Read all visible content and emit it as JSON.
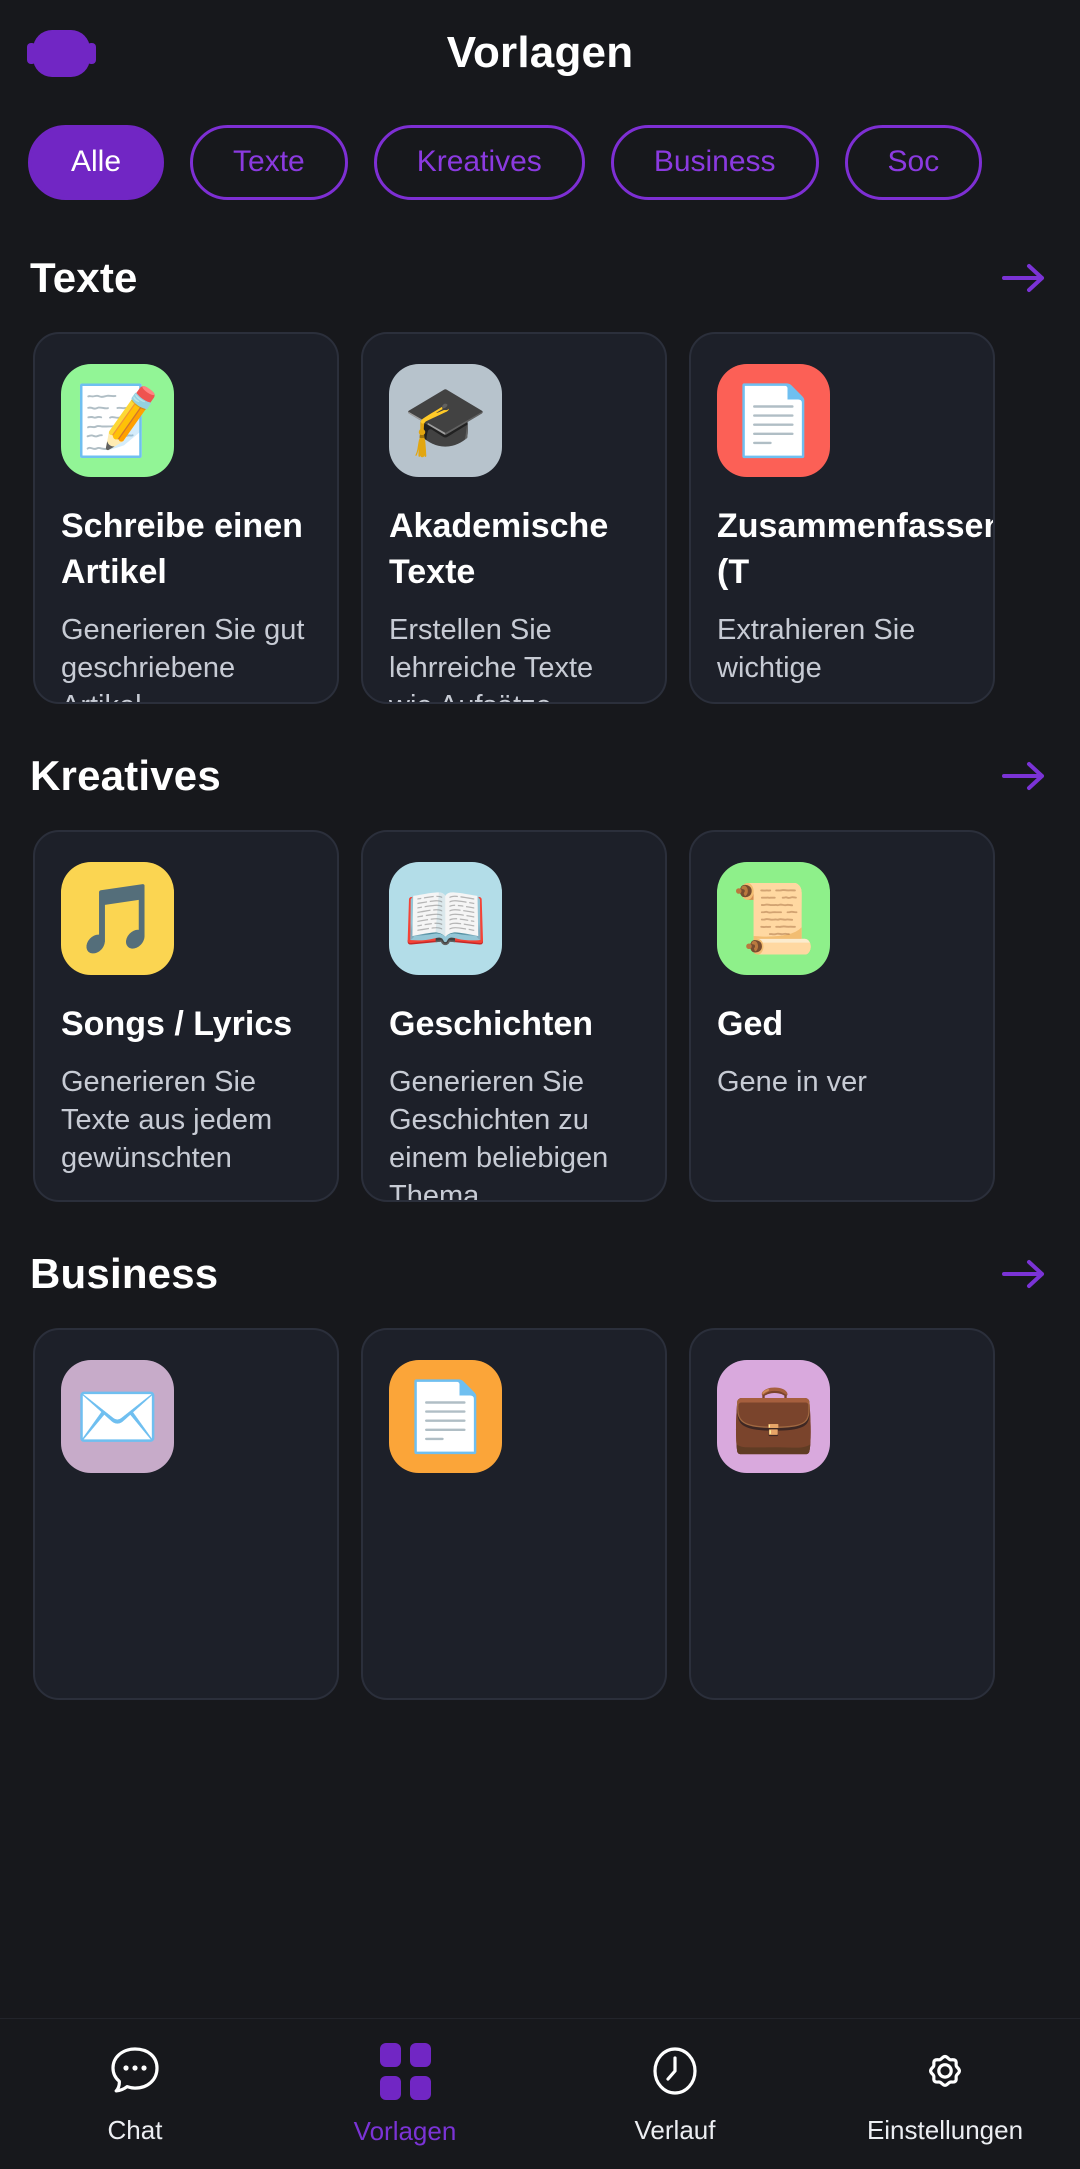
{
  "header": {
    "title": "Vorlagen",
    "logo_icon": "app-logo-icon"
  },
  "filters": {
    "items": [
      {
        "label": "Alle",
        "active": true
      },
      {
        "label": "Texte",
        "active": false
      },
      {
        "label": "Kreatives",
        "active": false
      },
      {
        "label": "Business",
        "active": false
      },
      {
        "label": "Soc",
        "active": false
      }
    ]
  },
  "sections": [
    {
      "title": "Texte",
      "arrow_icon": "arrow-right-icon",
      "cards": [
        {
          "title": "Schreibe einen Artikel",
          "desc": "Generieren Sie gut geschriebene Artikel",
          "emoji": "📝",
          "tile_color": "#92f596",
          "icon_name": "memo-pencil-icon"
        },
        {
          "title": "Akademische Texte",
          "desc": "Erstellen Sie lehrreiche Texte wie Aufsätze,",
          "emoji": "🎓",
          "tile_color": "#b7c3cc",
          "icon_name": "graduation-cap-icon"
        },
        {
          "title": "Zusammenfassen (T",
          "desc": "Extrahieren Sie wichtige",
          "emoji": "📄",
          "tile_color": "#fc6056",
          "icon_name": "page-facing-up-icon"
        }
      ]
    },
    {
      "title": "Kreatives",
      "arrow_icon": "arrow-right-icon",
      "cards": [
        {
          "title": "Songs / Lyrics",
          "desc": "Generieren Sie Texte aus jedem gewünschten",
          "emoji": "🎵",
          "tile_color": "#fbd551",
          "icon_name": "musical-note-icon"
        },
        {
          "title": "Geschichten",
          "desc": "Generieren Sie Geschichten zu einem beliebigen Thema.",
          "emoji": "📖",
          "tile_color": "#b3dde8",
          "icon_name": "open-book-icon"
        },
        {
          "title": "Ged",
          "desc": "Gene in ver",
          "emoji": "📜",
          "tile_color": "#8ef08a",
          "icon_name": "scroll-icon"
        }
      ]
    },
    {
      "title": "Business",
      "arrow_icon": "arrow-right-icon",
      "cards": [
        {
          "title": "",
          "desc": "",
          "emoji": "✉️",
          "tile_color": "#c7abc9",
          "icon_name": "envelope-icon"
        },
        {
          "title": "",
          "desc": "",
          "emoji": "📄",
          "tile_color": "#fba539",
          "icon_name": "page-with-curl-icon"
        },
        {
          "title": "",
          "desc": "",
          "emoji": "💼",
          "tile_color": "#d9a9dd",
          "icon_name": "briefcase-icon"
        }
      ]
    }
  ],
  "tabbar": {
    "items": [
      {
        "label": "Chat",
        "icon": "chat-bubble-icon",
        "active": false
      },
      {
        "label": "Vorlagen",
        "icon": "grid-squares-icon",
        "active": true
      },
      {
        "label": "Verlauf",
        "icon": "clock-icon",
        "active": false
      },
      {
        "label": "Einstellungen",
        "icon": "gear-icon",
        "active": false
      }
    ]
  },
  "colors": {
    "background": "#17181c",
    "card": "#1d2029",
    "accent": "#7126c4",
    "accent_light": "#8b3ae0"
  }
}
